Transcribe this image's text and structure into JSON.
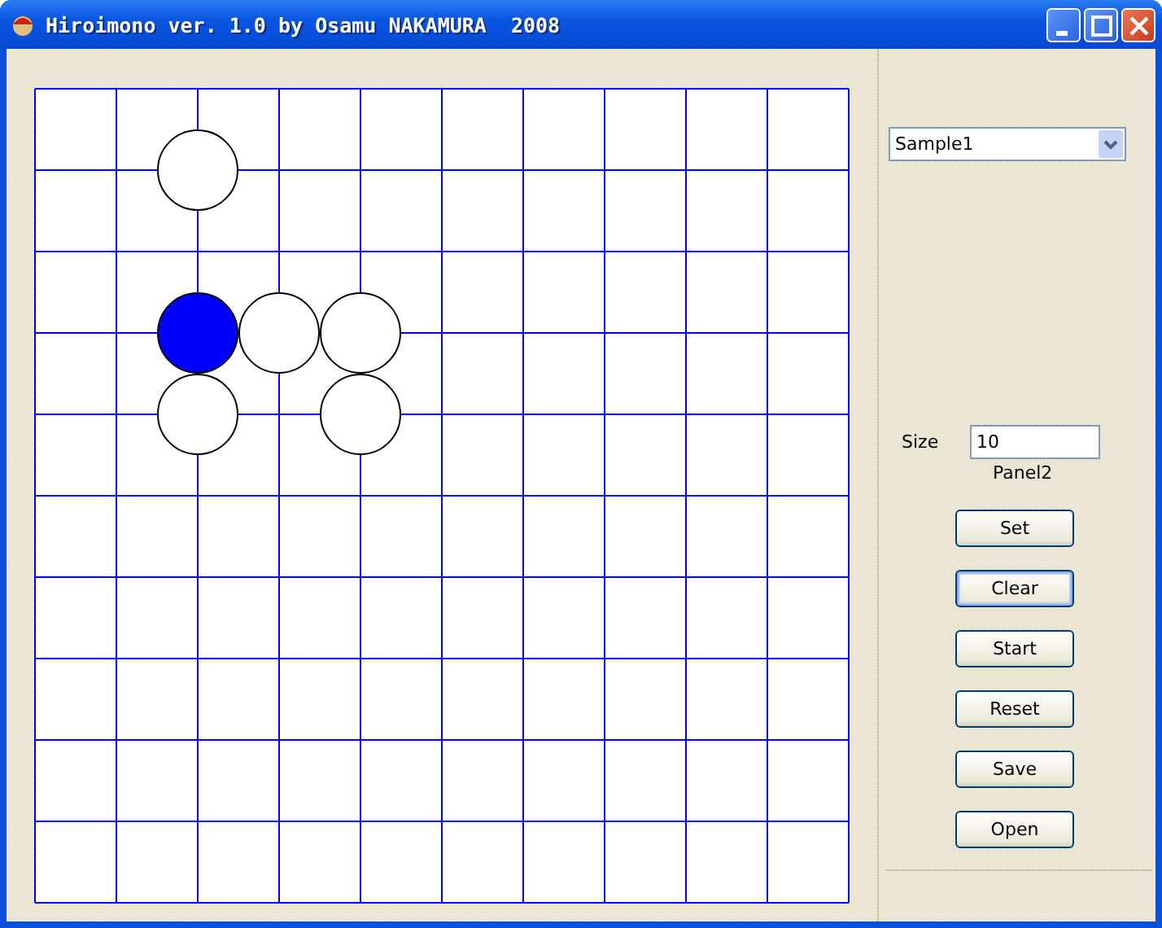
{
  "window": {
    "title": "Hiroimono ver. 1.0 by Osamu NAKAMURA  2008"
  },
  "board": {
    "rows": [
      {
        "points": [
          {
            "kind": "empty"
          },
          {
            "kind": "empty"
          },
          {
            "kind": "empty"
          },
          {
            "kind": "empty"
          },
          {
            "kind": "empty"
          },
          {
            "kind": "empty"
          },
          {
            "kind": "empty"
          },
          {
            "kind": "empty"
          },
          {
            "kind": "empty"
          },
          {
            "kind": "empty"
          },
          {
            "kind": "empty"
          }
        ]
      },
      {
        "points": [
          {
            "kind": "empty"
          },
          {
            "kind": "empty"
          },
          {
            "kind": "stone",
            "color": "#ffffff"
          },
          {
            "kind": "empty"
          },
          {
            "kind": "empty"
          },
          {
            "kind": "empty"
          },
          {
            "kind": "empty"
          },
          {
            "kind": "empty"
          },
          {
            "kind": "empty"
          },
          {
            "kind": "empty"
          },
          {
            "kind": "empty"
          }
        ]
      },
      {
        "points": [
          {
            "kind": "empty"
          },
          {
            "kind": "empty"
          },
          {
            "kind": "empty"
          },
          {
            "kind": "empty"
          },
          {
            "kind": "empty"
          },
          {
            "kind": "empty"
          },
          {
            "kind": "empty"
          },
          {
            "kind": "empty"
          },
          {
            "kind": "empty"
          },
          {
            "kind": "empty"
          },
          {
            "kind": "empty"
          }
        ]
      },
      {
        "points": [
          {
            "kind": "empty"
          },
          {
            "kind": "empty"
          },
          {
            "kind": "stone",
            "color": "#0000ff"
          },
          {
            "kind": "stone",
            "color": "#ffffff"
          },
          {
            "kind": "stone",
            "color": "#ffffff"
          },
          {
            "kind": "empty"
          },
          {
            "kind": "empty"
          },
          {
            "kind": "empty"
          },
          {
            "kind": "empty"
          },
          {
            "kind": "empty"
          },
          {
            "kind": "empty"
          }
        ]
      },
      {
        "points": [
          {
            "kind": "empty"
          },
          {
            "kind": "empty"
          },
          {
            "kind": "stone",
            "color": "#ffffff"
          },
          {
            "kind": "empty"
          },
          {
            "kind": "stone",
            "color": "#ffffff"
          },
          {
            "kind": "empty"
          },
          {
            "kind": "empty"
          },
          {
            "kind": "empty"
          },
          {
            "kind": "empty"
          },
          {
            "kind": "empty"
          },
          {
            "kind": "empty"
          }
        ]
      },
      {
        "points": [
          {
            "kind": "empty"
          },
          {
            "kind": "empty"
          },
          {
            "kind": "empty"
          },
          {
            "kind": "empty"
          },
          {
            "kind": "empty"
          },
          {
            "kind": "empty"
          },
          {
            "kind": "empty"
          },
          {
            "kind": "empty"
          },
          {
            "kind": "empty"
          },
          {
            "kind": "empty"
          },
          {
            "kind": "empty"
          }
        ]
      },
      {
        "points": [
          {
            "kind": "empty"
          },
          {
            "kind": "empty"
          },
          {
            "kind": "empty"
          },
          {
            "kind": "empty"
          },
          {
            "kind": "empty"
          },
          {
            "kind": "empty"
          },
          {
            "kind": "empty"
          },
          {
            "kind": "empty"
          },
          {
            "kind": "empty"
          },
          {
            "kind": "empty"
          },
          {
            "kind": "empty"
          }
        ]
      },
      {
        "points": [
          {
            "kind": "empty"
          },
          {
            "kind": "empty"
          },
          {
            "kind": "empty"
          },
          {
            "kind": "empty"
          },
          {
            "kind": "empty"
          },
          {
            "kind": "empty"
          },
          {
            "kind": "empty"
          },
          {
            "kind": "empty"
          },
          {
            "kind": "empty"
          },
          {
            "kind": "empty"
          },
          {
            "kind": "empty"
          }
        ]
      },
      {
        "points": [
          {
            "kind": "empty"
          },
          {
            "kind": "empty"
          },
          {
            "kind": "empty"
          },
          {
            "kind": "empty"
          },
          {
            "kind": "empty"
          },
          {
            "kind": "empty"
          },
          {
            "kind": "empty"
          },
          {
            "kind": "empty"
          },
          {
            "kind": "empty"
          },
          {
            "kind": "empty"
          },
          {
            "kind": "empty"
          }
        ]
      },
      {
        "points": [
          {
            "kind": "empty"
          },
          {
            "kind": "empty"
          },
          {
            "kind": "empty"
          },
          {
            "kind": "empty"
          },
          {
            "kind": "empty"
          },
          {
            "kind": "empty"
          },
          {
            "kind": "empty"
          },
          {
            "kind": "empty"
          },
          {
            "kind": "empty"
          },
          {
            "kind": "empty"
          },
          {
            "kind": "empty"
          }
        ]
      },
      {
        "points": [
          {
            "kind": "empty"
          },
          {
            "kind": "empty"
          },
          {
            "kind": "empty"
          },
          {
            "kind": "empty"
          },
          {
            "kind": "empty"
          },
          {
            "kind": "empty"
          },
          {
            "kind": "empty"
          },
          {
            "kind": "empty"
          },
          {
            "kind": "empty"
          },
          {
            "kind": "empty"
          },
          {
            "kind": "empty"
          }
        ]
      }
    ]
  },
  "sample_dropdown": {
    "value": "Sample1"
  },
  "size_field": {
    "label": "Size",
    "value": "10"
  },
  "panel_label": "Panel2",
  "buttons": [
    {
      "label": "Set",
      "focused": false
    },
    {
      "label": "Clear",
      "focused": true
    },
    {
      "label": "Start",
      "focused": false
    },
    {
      "label": "Reset",
      "focused": false
    },
    {
      "label": "Save",
      "focused": false
    },
    {
      "label": "Open",
      "focused": false
    }
  ]
}
